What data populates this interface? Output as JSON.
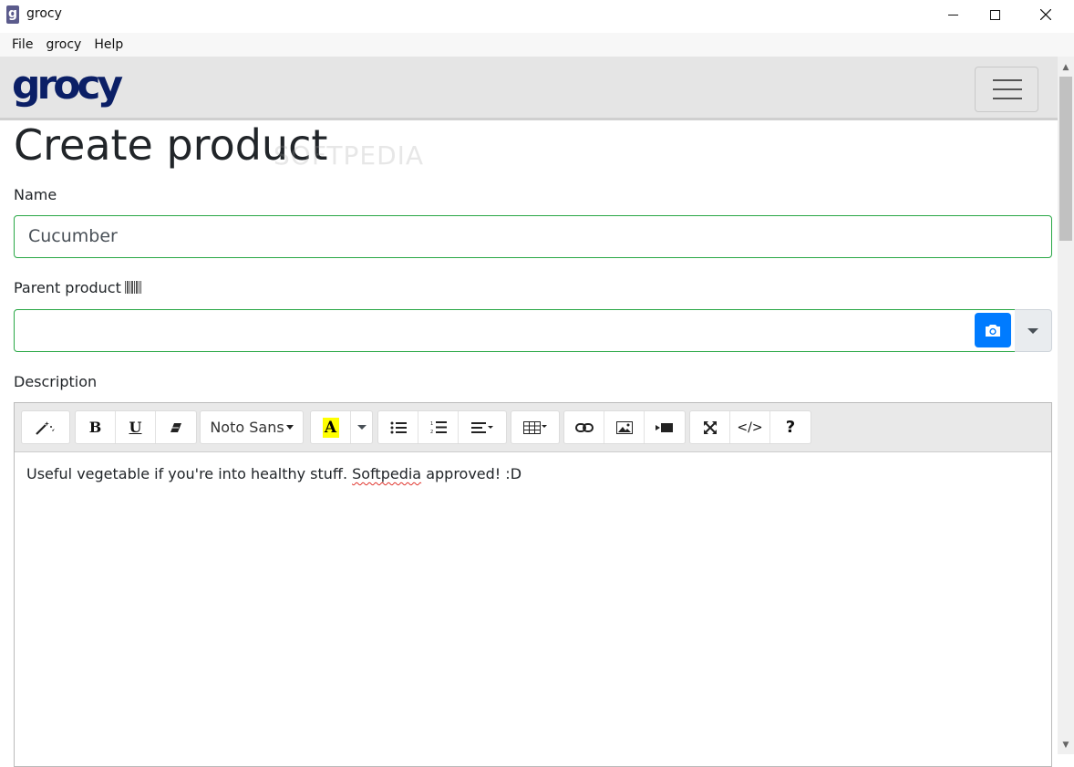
{
  "window": {
    "app_icon": "g",
    "title": "grocy"
  },
  "menu": [
    "File",
    "grocy",
    "Help"
  ],
  "navbar": {
    "brand": "grocy",
    "toggler_icon": "hamburger-icon"
  },
  "page": {
    "title": "Create product",
    "watermark": "SOFTPEDIA"
  },
  "form": {
    "name_label": "Name",
    "name_value": "Cucumber",
    "parent_label": "Parent product",
    "parent_value": "",
    "description_label": "Description"
  },
  "editor": {
    "font_name": "Noto Sans",
    "color_letter": "A",
    "bold_label": "B",
    "underline_label": "U",
    "help_label": "?",
    "code_label": "</>",
    "text_before": "Useful vegetable if you're into healthy stuff. ",
    "text_misspelled": "Softpedia",
    "text_after": " approved! :D"
  },
  "colors": {
    "valid_border": "#28a745",
    "primary": "#007bff",
    "brand": "#0b1f66",
    "highlight": "#ffff00"
  }
}
